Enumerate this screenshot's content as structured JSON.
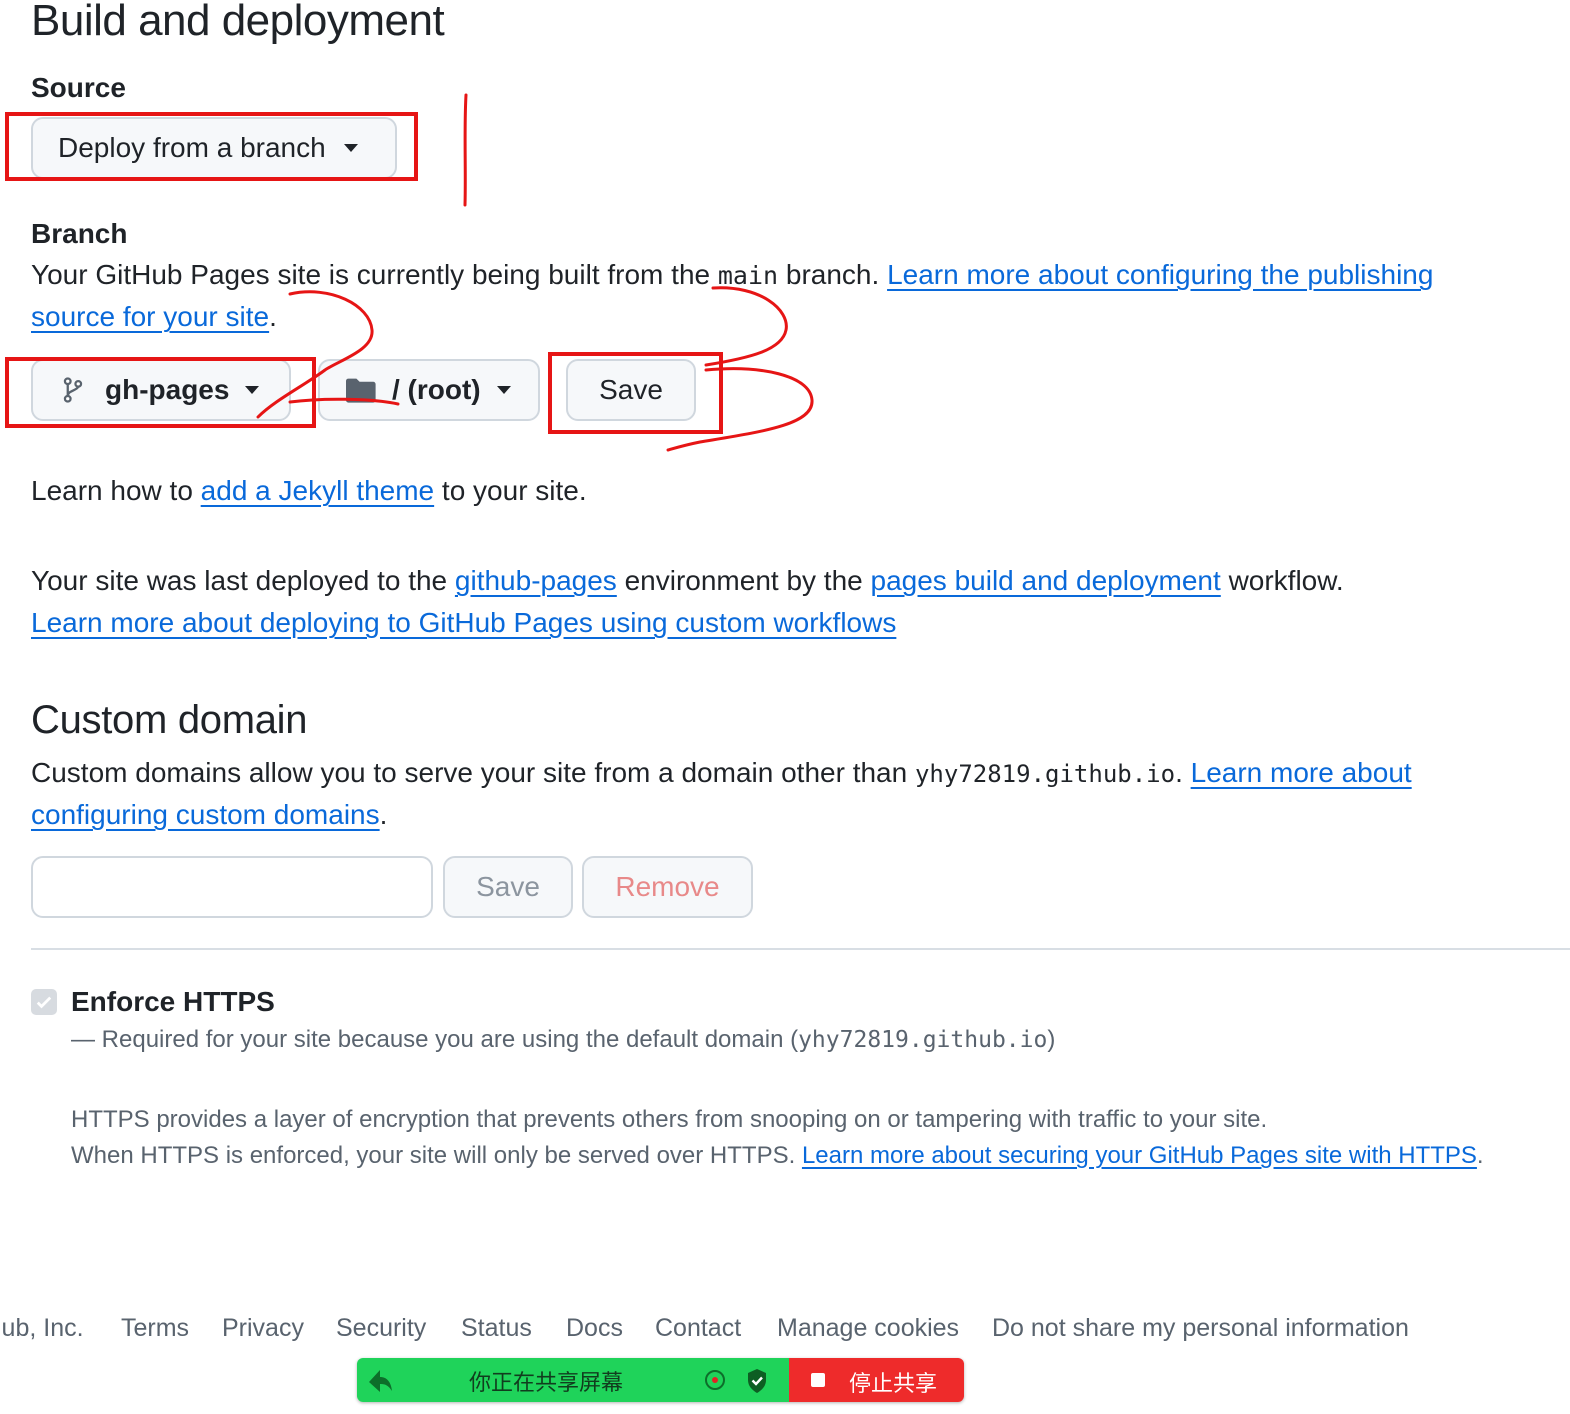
{
  "section": {
    "title": "Build and deployment"
  },
  "source": {
    "label": "Source",
    "dropdown_value": "Deploy from a branch"
  },
  "branch": {
    "label": "Branch",
    "desc_prefix": "Your GitHub Pages site is currently being built from the",
    "desc_code": "main",
    "desc_suffix": "branch.",
    "desc_link_line1": "Learn more about configuring the publishing",
    "desc_link_line2": "source for your site",
    "desc_end": ".",
    "branch_value": "gh-pages",
    "folder_value": "/ (root)",
    "save_label": "Save"
  },
  "jekyll": {
    "prefix": "Learn how to",
    "link": "add a Jekyll theme",
    "suffix": "to your site."
  },
  "deploy": {
    "prefix": "Your site was last deployed to the",
    "env_link": "github-pages",
    "middle": "environment by the",
    "workflow_link": "pages build and deployment",
    "suffix": "workflow.",
    "learn_link": "Learn more about deploying to GitHub Pages using custom workflows"
  },
  "custom_domain": {
    "title": "Custom domain",
    "desc_prefix": "Custom domains allow you to serve your site from a domain other than",
    "desc_code": "yhy72819.github.io",
    "desc_dot": ".",
    "desc_link_line1": "Learn more about",
    "desc_link_line2": "configuring custom domains",
    "desc_end": ".",
    "input_value": "",
    "save_label": "Save",
    "remove_label": "Remove"
  },
  "https": {
    "label": "Enforce HTTPS",
    "checked": true,
    "required_prefix": "— Required for your site because you are using the default domain (",
    "required_code": "yhy72819.github.io",
    "required_suffix": ")",
    "info_line1": "HTTPS provides a layer of encryption that prevents others from snooping on or tampering with traffic to your site.",
    "info_line2_prefix": "When HTTPS is enforced, your site will only be served over HTTPS.",
    "info_link": "Learn more about securing your GitHub Pages site with HTTPS",
    "info_end": "."
  },
  "footer": {
    "company": "lub, Inc.",
    "links": [
      "Terms",
      "Privacy",
      "Security",
      "Status",
      "Docs",
      "Contact",
      "Manage cookies",
      "Do not share my personal information"
    ]
  },
  "share_bar": {
    "status_text": "你正在共享屏幕",
    "stop_label": "停止共享",
    "colors": {
      "green": "#1fd35a",
      "red": "#ee2b2b"
    }
  },
  "colors": {
    "link": "#0969da",
    "annotation": "#e61515",
    "danger_text": "#e88989"
  }
}
